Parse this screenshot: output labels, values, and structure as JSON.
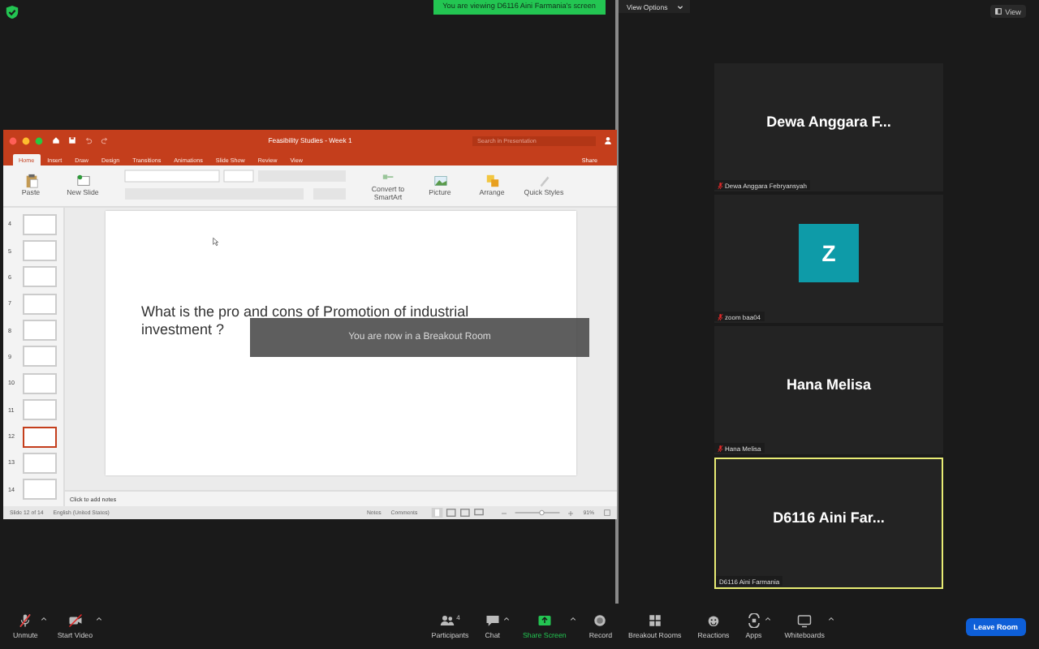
{
  "banner": "You are viewing D6116 Aini Farmania's screen",
  "view_options": "View Options",
  "view_button": "View",
  "shared_screen": {
    "title": "Feasibility Studies - Week 1",
    "search": {
      "placeholder": "Search in Presentation"
    },
    "tabs": [
      {
        "label": "Home",
        "selected": true
      },
      {
        "label": "Insert",
        "selected": false
      },
      {
        "label": "Draw",
        "selected": false
      },
      {
        "label": "Design",
        "selected": false
      },
      {
        "label": "Transitions",
        "selected": false
      },
      {
        "label": "Animations",
        "selected": false
      },
      {
        "label": "Slide Show",
        "selected": false
      },
      {
        "label": "Review",
        "selected": false
      },
      {
        "label": "View",
        "selected": false
      }
    ],
    "share": "Share",
    "ribbon": [
      {
        "kind": "paste",
        "label": "Paste"
      },
      {
        "kind": "slide",
        "label": "New Slide"
      },
      {
        "kind": "smartart",
        "label": "Convert to SmartArt"
      },
      {
        "kind": "picture",
        "label": "Picture"
      },
      {
        "kind": "arrange",
        "label": "Arrange"
      },
      {
        "kind": "styles",
        "label": "Quick Styles"
      }
    ],
    "thumbnails": [
      {
        "number": "4",
        "selected": false
      },
      {
        "number": "5",
        "selected": false
      },
      {
        "number": "6",
        "selected": false
      },
      {
        "number": "7",
        "selected": false
      },
      {
        "number": "8",
        "selected": false
      },
      {
        "number": "9",
        "selected": false
      },
      {
        "number": "10",
        "selected": false
      },
      {
        "number": "11",
        "selected": false
      },
      {
        "number": "12",
        "selected": true
      },
      {
        "number": "13",
        "selected": false
      },
      {
        "number": "14",
        "selected": false
      }
    ],
    "slide_text_lines": [
      "What is the pro and cons of Promotion of industrial",
      "investment ?"
    ],
    "notes": {
      "placeholder": "Click to add notes"
    },
    "status_bar": {
      "slide": "Slide 12 of 14",
      "language": "English (United States)",
      "notes": "Notes",
      "comments": "Comments",
      "zoom_slider": {
        "level": 0.6
      },
      "zoom": "91%"
    }
  },
  "notification": "You are now in a Breakout Room",
  "participants": [
    {
      "kind": "name",
      "display_name": "Dewa Anggara F...",
      "label": "Dewa Anggara Febryansyah",
      "muted": true,
      "speaking": false
    },
    {
      "kind": "avatar",
      "initial": "Z",
      "label": "zoom baa04",
      "muted": true,
      "speaking": false
    },
    {
      "kind": "name",
      "display_name": "Hana Melisa",
      "label": "Hana Melisa",
      "muted": true,
      "speaking": false
    },
    {
      "kind": "name",
      "display_name": "D6116 Aini Far...",
      "label": "D6116 Aini Farmania",
      "muted": false,
      "speaking": true
    }
  ],
  "toolbar": [
    {
      "kind": "mic",
      "label": "Unmute",
      "menu": true
    },
    {
      "kind": "video",
      "label": "Start Video",
      "menu": true
    },
    {
      "kind": "participants",
      "label": "Participants",
      "count": "4",
      "menu": false
    },
    {
      "kind": "chat",
      "label": "Chat",
      "menu": true
    },
    {
      "kind": "share",
      "label": "Share Screen",
      "menu": true
    },
    {
      "kind": "record",
      "label": "Record",
      "menu": false
    },
    {
      "kind": "breakout",
      "label": "Breakout Rooms",
      "menu": false
    },
    {
      "kind": "reactions",
      "label": "Reactions",
      "menu": false
    },
    {
      "kind": "apps",
      "label": "Apps",
      "menu": true
    },
    {
      "kind": "whiteboard",
      "label": "Whiteboards",
      "menu": true
    }
  ],
  "leave_button": "Leave Room"
}
